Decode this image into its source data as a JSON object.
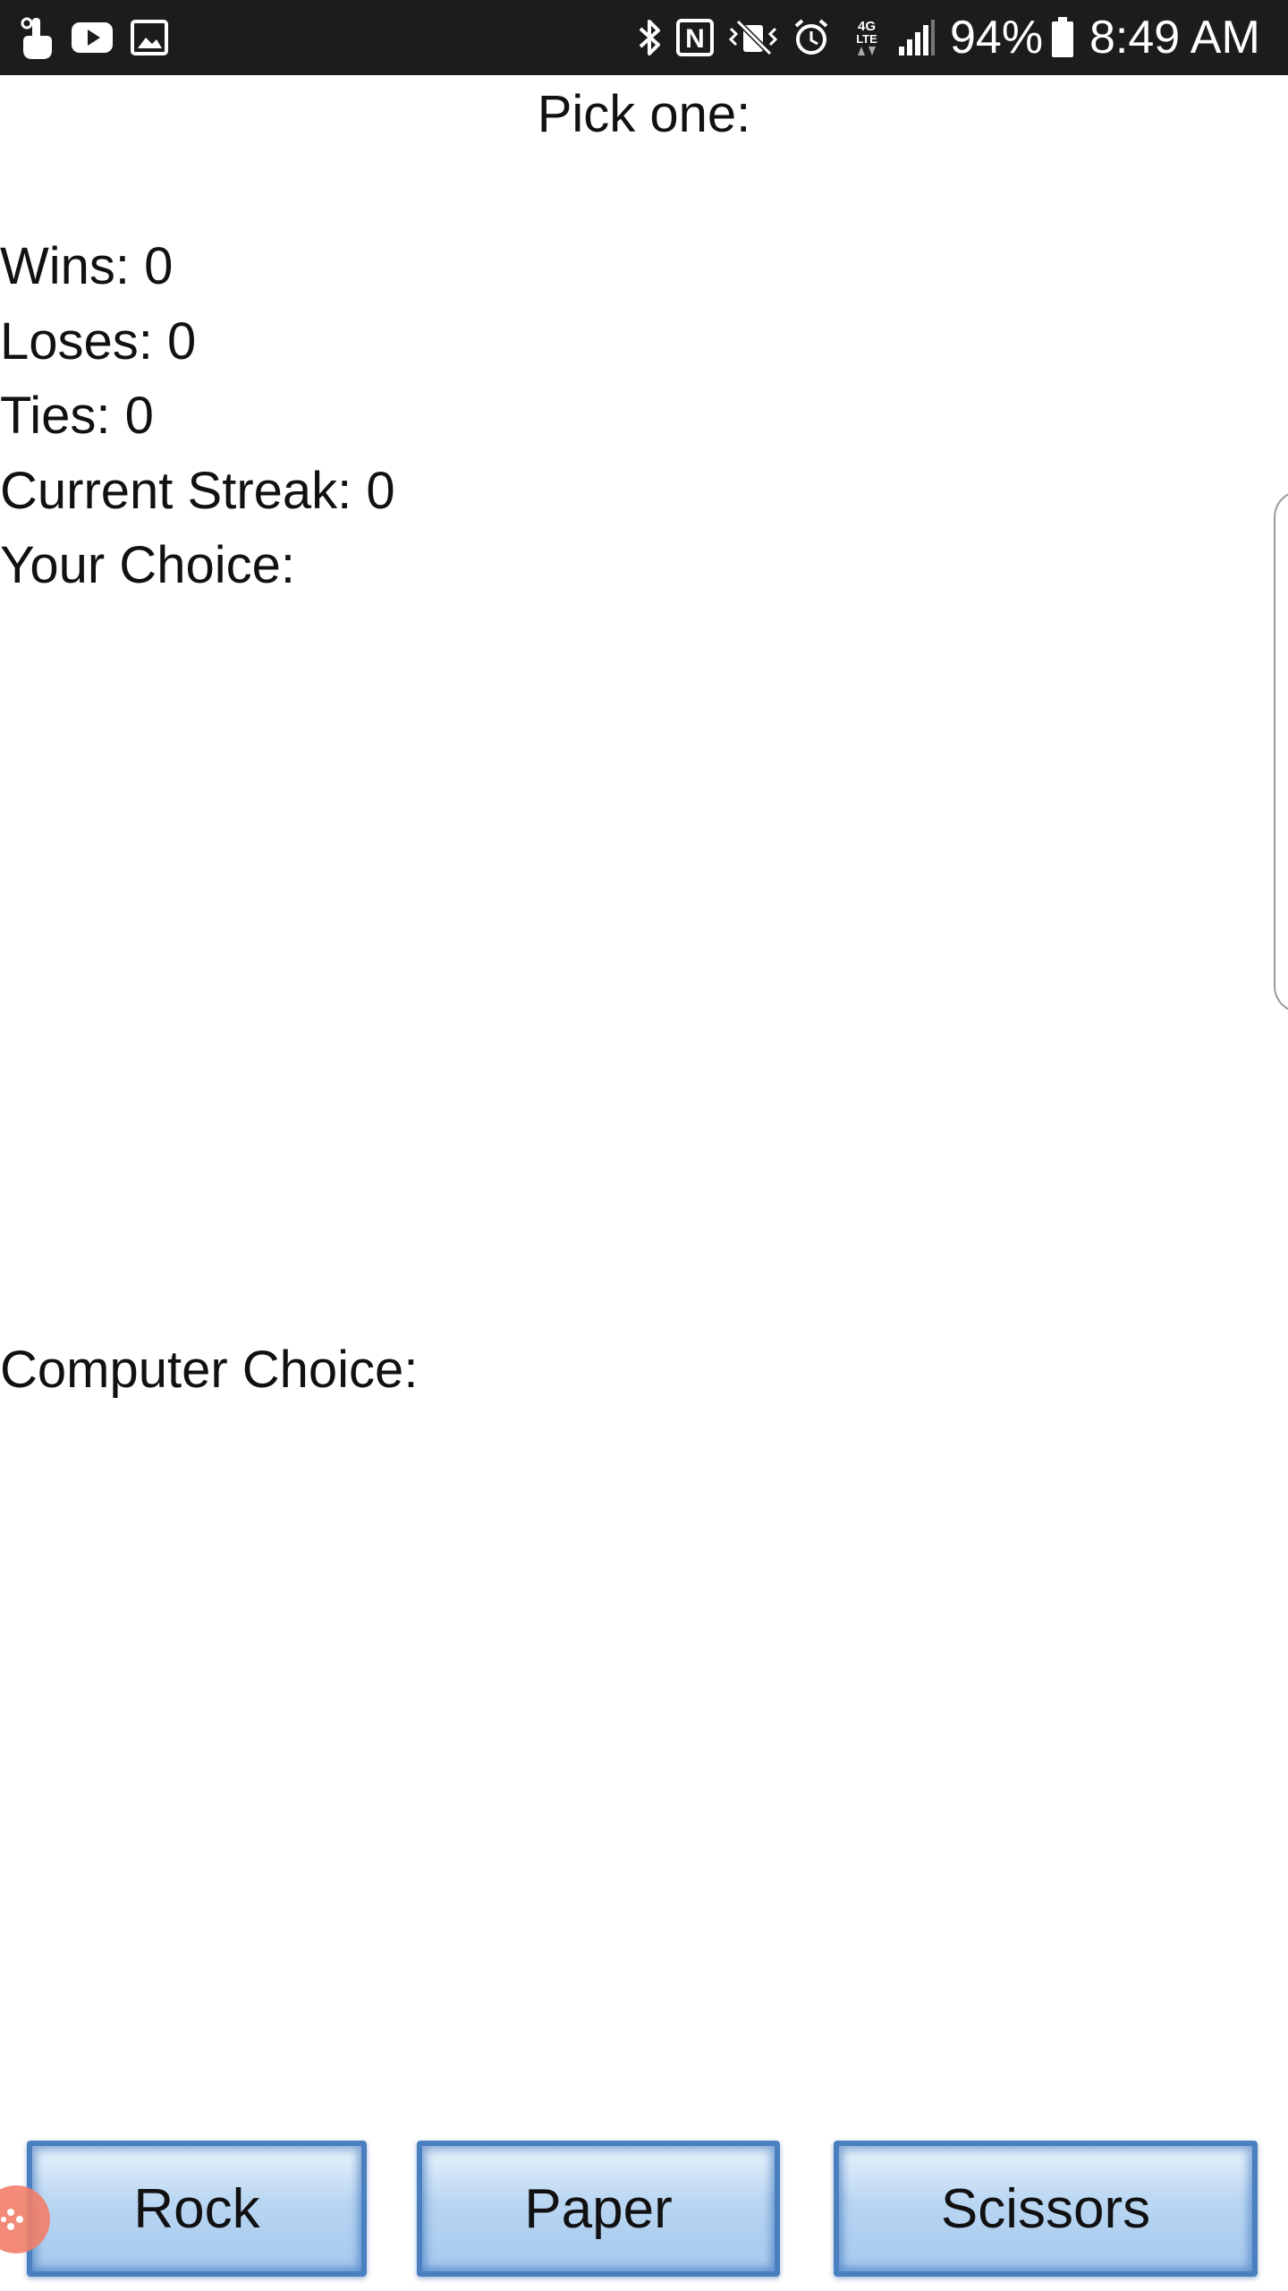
{
  "status_bar": {
    "battery_percent": "94%",
    "time": "8:49 AM",
    "left_icons": [
      "touch-icon",
      "youtube-icon",
      "gallery-icon"
    ],
    "right_icons": [
      "bluetooth-icon",
      "nfc-icon",
      "vibrate-icon",
      "alarm-icon",
      "lte-icon",
      "signal-icon",
      "battery-icon"
    ]
  },
  "game": {
    "prompt": "Pick one:",
    "wins": "Wins: 0",
    "loses": "Loses: 0",
    "ties": "Ties: 0",
    "streak": "Current Streak: 0",
    "your_choice_label": "Your Choice:",
    "computer_choice_label": "Computer Choice:"
  },
  "buttons": {
    "rock": "Rock",
    "paper": "Paper",
    "scissors": "Scissors"
  },
  "colors": {
    "status_bar_bg": "#1c1c1c",
    "button_border": "#4a7fc0",
    "button_fill": "#b9d6f2",
    "bubble": "#f27f6a"
  }
}
